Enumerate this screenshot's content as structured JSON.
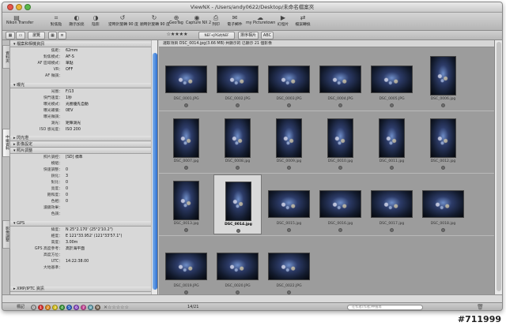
{
  "window": {
    "title": "ViewNX - /Users/andy0622/Desktop/未命名檔案夾"
  },
  "toolbar": {
    "items": [
      {
        "label": "Nikon Transfer",
        "icon": "▤"
      },
      {
        "label": "對焦點",
        "icon": "⌗"
      },
      {
        "label": "顯示加亮",
        "icon": "◐"
      },
      {
        "label": "陰影",
        "icon": "◑"
      },
      {
        "label": "逆時針旋轉 90 度",
        "icon": "↺"
      },
      {
        "label": "順時針旋轉 90 度",
        "icon": "↻"
      },
      {
        "label": "GeoTag",
        "icon": "⊕"
      },
      {
        "label": "Capture NX 2",
        "icon": "◉"
      },
      {
        "label": "列印",
        "icon": "⎙"
      },
      {
        "label": "電子郵件",
        "icon": "✉"
      },
      {
        "label": "my Picturetown",
        "icon": "☁"
      },
      {
        "label": "幻燈片",
        "icon": "▶"
      },
      {
        "label": "檔案轉換",
        "icon": "⇄"
      }
    ]
  },
  "subbar": {
    "browser_label": "瀏覽",
    "filter_stars": "☆★★★★",
    "filter_label": "NEF+JPG的NEF",
    "sort_label": "排序相片",
    "abc": "ABC"
  },
  "vtabs": [
    "資料夾",
    "中繼資料",
    "影像調整"
  ],
  "panel": {
    "sections": [
      {
        "title": "▾ 檔案和相機資訊"
      },
      {
        "title": "▾ 曝光"
      },
      {
        "title": "▸ 閃光燈"
      },
      {
        "title": "▸ 影像設定"
      },
      {
        "title": "▾ 照片調整"
      },
      {
        "title": "▾ GPS"
      },
      {
        "title": "▸ XMP/IPTC 資訊"
      }
    ],
    "camera_rows": [
      {
        "k": "焦距：",
        "v": "62mm"
      },
      {
        "k": "對焦模式：",
        "v": "AF-S"
      },
      {
        "k": "AF 區域模式：",
        "v": "單點"
      },
      {
        "k": "VR：",
        "v": "OFF"
      },
      {
        "k": "AF 微調：",
        "v": ""
      }
    ],
    "exposure_rows": [
      {
        "k": "光圈：",
        "v": "F/13"
      },
      {
        "k": "快門速度：",
        "v": "1秒"
      },
      {
        "k": "曝光模式：",
        "v": "光圈優先自動"
      },
      {
        "k": "曝光補償：",
        "v": "0EV"
      },
      {
        "k": "曝光微調：",
        "v": ""
      },
      {
        "k": "測光：",
        "v": "矩陣測光"
      },
      {
        "k": "ISO 感光度：",
        "v": "ISO 200"
      }
    ],
    "picture_rows": [
      {
        "k": "照片調控：",
        "v": "[SD] 標準"
      },
      {
        "k": "模組：",
        "v": ""
      },
      {
        "k": "快速調整：",
        "v": "0"
      },
      {
        "k": "銳化：",
        "v": "3"
      },
      {
        "k": "對比：",
        "v": "0"
      },
      {
        "k": "亮度：",
        "v": "0"
      },
      {
        "k": "飽和度：",
        "v": "0"
      },
      {
        "k": "色相：",
        "v": "0"
      },
      {
        "k": "濾鏡效果：",
        "v": ""
      },
      {
        "k": "色調：",
        "v": ""
      }
    ],
    "gps_rows": [
      {
        "k": "緯度：",
        "v": "N 25°2.170' (25°2'10.2\")"
      },
      {
        "k": "經度：",
        "v": "E 121°33.952' (121°33'57.1\")"
      },
      {
        "k": "高度：",
        "v": "3.00m"
      },
      {
        "k": "GPS 高度參考：",
        "v": "高於海平面"
      },
      {
        "k": "高度方位：",
        "v": ""
      },
      {
        "k": "UTC：",
        "v": "14:22:38.00"
      },
      {
        "k": "大地基準：",
        "v": ""
      }
    ]
  },
  "main": {
    "info": "選取項目 DSC_0014.jpg(3.66 MB) 共顯示的 已顯示 21 個影像",
    "thumbnails": [
      {
        "name": "DSC_0001.JPG"
      },
      {
        "name": "DSC_0002.JPG"
      },
      {
        "name": "DSC_0003.JPG"
      },
      {
        "name": "DSC_0004.JPG"
      },
      {
        "name": "DSC_0005.JPG"
      },
      {
        "name": "DSC_0006.jpg"
      },
      {
        "name": "DSC_0007.jpg"
      },
      {
        "name": "DSC_0008.jpg"
      },
      {
        "name": "DSC_0009.jpg"
      },
      {
        "name": "DSC_0010.jpg"
      },
      {
        "name": "DSC_0011.jpg"
      },
      {
        "name": "DSC_0012.jpg"
      },
      {
        "name": "DSC_0013.jpg"
      },
      {
        "name": "DSC_0014.jpg",
        "selected": true
      },
      {
        "name": "DSC_0015.jpg"
      },
      {
        "name": "DSC_0016.jpg"
      },
      {
        "name": "DSC_0017.jpg"
      },
      {
        "name": "DSC_0018.jpg"
      },
      {
        "name": "DSC_0019.JPG"
      },
      {
        "name": "DSC_0020.JPG"
      },
      {
        "name": "DSC_0022.JPG"
      }
    ]
  },
  "bottom": {
    "label_text": "標記",
    "labels": [
      "0",
      "1",
      "2",
      "3",
      "4",
      "5",
      "6",
      "7",
      "8",
      "9"
    ],
    "label_colors": [
      "#9a9a9a",
      "#d33",
      "#e08a1f",
      "#d8c21a",
      "#3a9a3a",
      "#2d64c8",
      "#8a4bc8",
      "#c84b9a",
      "#5a9aa8",
      "#7a6a5a"
    ],
    "rating": "✕☆☆☆☆☆",
    "page_count": "14/21",
    "search_placeholder": "在作者(作者)中搜尋"
  },
  "watermark": "#711999"
}
